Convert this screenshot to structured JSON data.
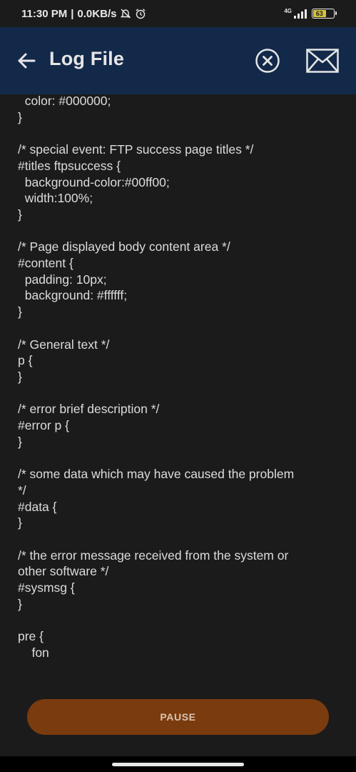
{
  "status_bar": {
    "time": "11:30 PM",
    "separator": "|",
    "speed": "0.0KB/s",
    "network_type": "4G",
    "battery_level": "63"
  },
  "app_bar": {
    "title": "Log File",
    "background": "#13294a"
  },
  "log": {
    "lines": "  color: #000000;\n}\n\n/* special event: FTP success page titles */\n#titles ftpsuccess {\n  background-color:#00ff00;\n  width:100%;\n}\n\n/* Page displayed body content area */\n#content {\n  padding: 10px;\n  background: #ffffff;\n}\n\n/* General text */\np {\n}\n\n/* error brief description */\n#error p {\n}\n\n/* some data which may have caused the problem\n*/\n#data {\n}\n\n/* the error message received from the system or\nother software */\n#sysmsg {\n}\n\npre {\n    fon"
  },
  "actions": {
    "pause_label": "PAUSE",
    "pause_color": "#7a3b0e"
  }
}
